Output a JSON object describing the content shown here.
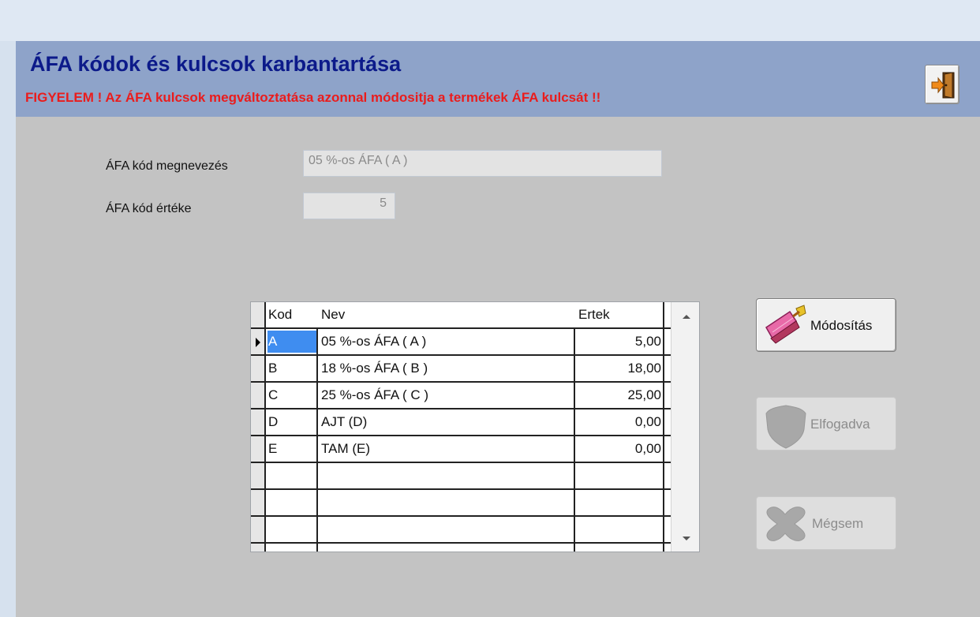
{
  "form": {
    "title": "ÁFA kódok és kulcsok karbantartása",
    "warning": "FIGYELEM ! Az ÁFA kulcsok megváltoztatása azonnal módositja a termékek ÁFA kulcsát !!"
  },
  "fields": {
    "name_label": "ÁFA kód megnevezés",
    "name_value": "05 %-os ÁFA ( A )",
    "value_label": "ÁFA kód értéke",
    "value_value": "5"
  },
  "grid": {
    "columns": [
      "Kod",
      "Nev",
      "Ertek"
    ],
    "rows": [
      {
        "kod": "A",
        "nev": "05 %-os ÁFA ( A )",
        "ertek": "5,00"
      },
      {
        "kod": "B",
        "nev": "18 %-os ÁFA ( B )",
        "ertek": "18,00"
      },
      {
        "kod": "C",
        "nev": "25 %-os ÁFA ( C )",
        "ertek": "25,00"
      },
      {
        "kod": "D",
        "nev": "AJT (D)",
        "ertek": "0,00"
      },
      {
        "kod": "E",
        "nev": "TAM (E)",
        "ertek": "0,00"
      }
    ],
    "selected_row": 0
  },
  "buttons": {
    "modify_label": "Módosítás",
    "accept_label": "Elfogadva",
    "cancel_label": "Mégsem"
  },
  "icons": {
    "exit": "exit-door-icon",
    "modify": "edit-brush-icon",
    "accept": "shield-icon",
    "cancel": "cross-icon"
  },
  "colors": {
    "header_bg": "#8ea3c9",
    "title": "#0c1a8a",
    "warning": "#ea1c1c",
    "form_bg": "#c3c3c3",
    "selection": "#3f8df0"
  }
}
